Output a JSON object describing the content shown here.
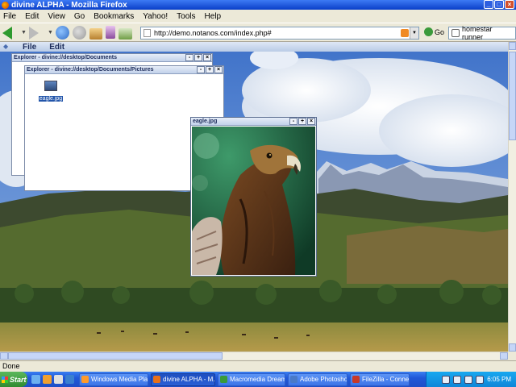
{
  "browser": {
    "title": "divine ALPHA - Mozilla Firefox",
    "menu": [
      "File",
      "Edit",
      "View",
      "Go",
      "Bookmarks",
      "Yahoo!",
      "Tools",
      "Help"
    ],
    "url": "http://demo.notanos.com/index.php#",
    "go_label": "Go",
    "search_value": "homestar runner",
    "status": "Done"
  },
  "app": {
    "menu": [
      "File",
      "Edit"
    ]
  },
  "windows": {
    "explorer1": {
      "title": "Explorer - divine://desktop/Documents"
    },
    "explorer2": {
      "title": "Explorer - divine://desktop/Documents/Pictures",
      "file": "eagle.jpg"
    },
    "image": {
      "title": "eagle.jpg"
    }
  },
  "taskbar": {
    "start": "Start",
    "tasks": [
      "Windows Media Player",
      "divine ALPHA - M...",
      "Macromedia Dream...",
      "Adobe Photoshop",
      "FileZilla - Connected..."
    ],
    "clock": "6:05 PM"
  }
}
